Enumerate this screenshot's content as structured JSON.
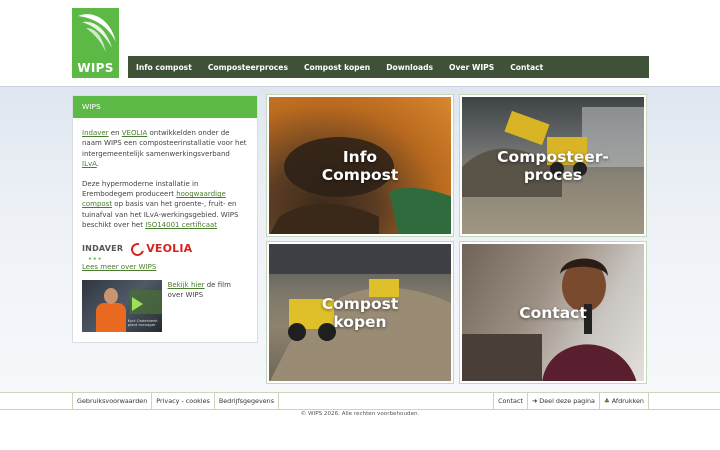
{
  "brand": {
    "logo_text": "WIPS"
  },
  "nav": {
    "items": [
      "Info compost",
      "Composteerproces",
      "Compost kopen",
      "Downloads",
      "Over WIPS",
      "Contact"
    ]
  },
  "sidebar": {
    "title": "WIPS",
    "p1": {
      "link1": "Indaver",
      "t1": " en ",
      "link2": "VEOLIA",
      "t2": " ontwikkelden onder de naam WIPS een composteerinstallatie voor het intergemeentelijk samenwerkingsverband ",
      "link3": "ILvA",
      "t3": "."
    },
    "p2": {
      "t1": "Deze hypermoderne installatie in Erembodegem produceert ",
      "link1": "hoogwaardige compost",
      "t2": " op basis van het groente-, fruit- en tuinafval van het ILvA-werkingsgebied. WIPS beschikt over het ",
      "link2": "ISO14001 certificaat"
    },
    "partners": {
      "indaver": "INDAVER",
      "veolia": "VEOLIA"
    },
    "more_link": "Lees meer over WIPS",
    "video": {
      "link": "Bekijk hier",
      "text": " de film over WIPS",
      "caption_name": "Kurt Onderbeek",
      "caption_role": "plant manager"
    }
  },
  "tiles": [
    {
      "label_line1": "Info",
      "label_line2": "Compost"
    },
    {
      "label_line1": "Composteer-",
      "label_line2": "proces"
    },
    {
      "label_line1": "Compost",
      "label_line2": "kopen"
    },
    {
      "label_line1": "Contact",
      "label_line2": ""
    }
  ],
  "footer": {
    "left_links": [
      "Gebruiksvoorwaarden",
      "Privacy - cookies",
      "Bedrijfsgegevens"
    ],
    "right_links": [
      "Contact",
      "Deel deze pagina",
      "Afdrukken"
    ],
    "copyright": "© WIPS  2026. Alle rechten voorbehouden."
  },
  "colors": {
    "brand_green": "#5cb946",
    "nav_dark_green": "#3f5238",
    "link_green": "#4b7d2f"
  }
}
